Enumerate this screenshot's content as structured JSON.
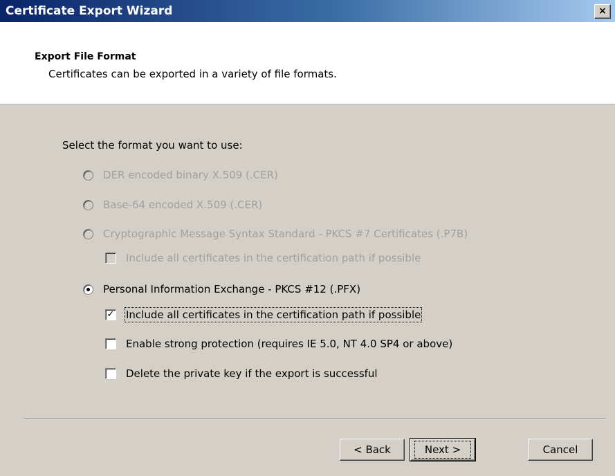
{
  "window": {
    "title": "Certificate Export Wizard",
    "close_glyph": "×"
  },
  "header": {
    "title": "Export File Format",
    "subtitle": "Certificates can be exported in a variety of file formats."
  },
  "body": {
    "prompt": "Select the format you want to use:",
    "options": [
      {
        "label": "DER encoded binary X.509 (.CER)",
        "enabled": false,
        "selected": false
      },
      {
        "label": "Base-64 encoded X.509 (.CER)",
        "enabled": false,
        "selected": false
      },
      {
        "label": "Cryptographic Message Syntax Standard - PKCS #7 Certificates (.P7B)",
        "enabled": false,
        "selected": false
      },
      {
        "label": "Personal Information Exchange - PKCS #12 (.PFX)",
        "enabled": true,
        "selected": true
      }
    ],
    "p7b_include_all": {
      "label": "Include all certificates in the certification path if possible",
      "enabled": false,
      "checked": false
    },
    "pfx_options": [
      {
        "label": "Include all certificates in the certification path if possible",
        "checked": true
      },
      {
        "label": "Enable strong protection (requires IE 5.0, NT 4.0 SP4 or above)",
        "checked": false
      },
      {
        "label": "Delete the private key if the export is successful",
        "checked": false
      }
    ]
  },
  "buttons": {
    "back": "< Back",
    "next": "Next >",
    "cancel": "Cancel"
  },
  "check_glyph": "✓"
}
